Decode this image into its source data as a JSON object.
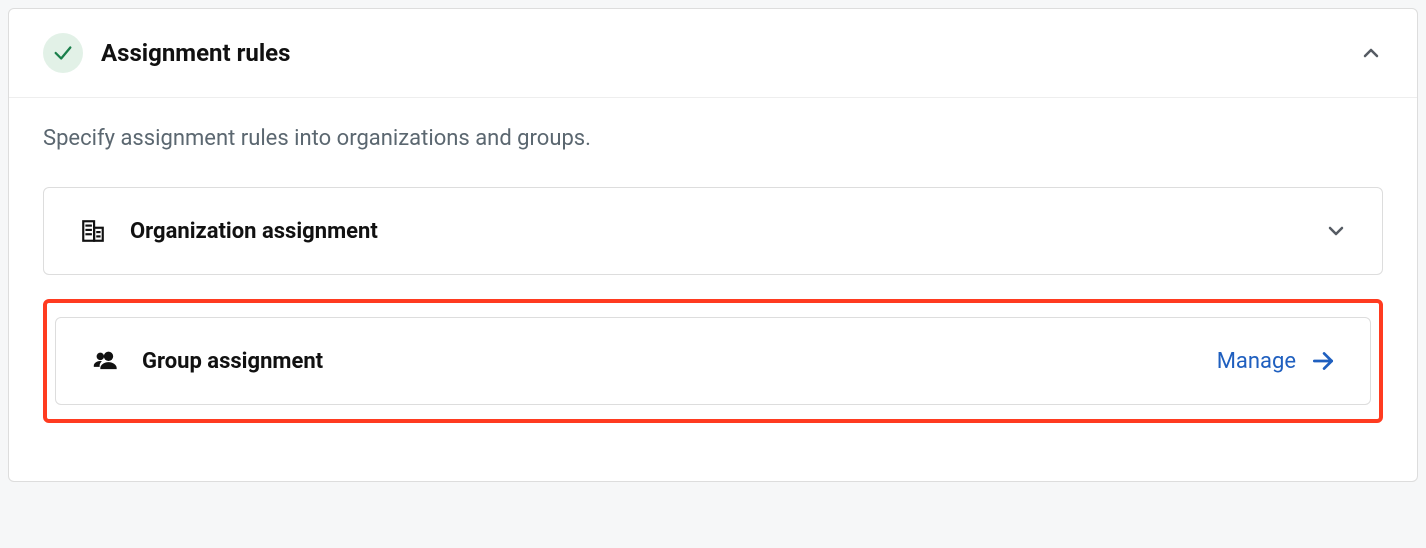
{
  "panel": {
    "title": "Assignment rules",
    "description": "Specify assignment rules into organizations and groups.",
    "expanded": true
  },
  "rows": {
    "organization": {
      "title": "Organization assignment"
    },
    "group": {
      "title": "Group assignment",
      "action_label": "Manage"
    }
  }
}
